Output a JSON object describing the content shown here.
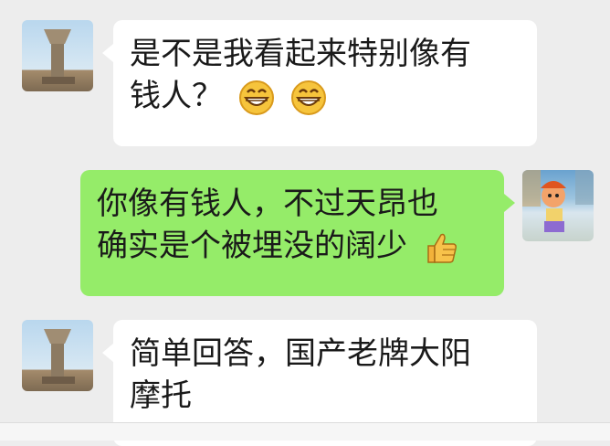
{
  "chat": {
    "messages": [
      {
        "side": "left",
        "text_line1": "是不是我看起来特别像有",
        "text_line2": "钱人？",
        "emojis": [
          "grin-emoji",
          "grin-emoji"
        ]
      },
      {
        "side": "right",
        "text_line1": "你像有钱人，不过天昂也",
        "text_line2": "确实是个被埋没的阔少",
        "emojis": [
          "thumbs-up-emoji"
        ]
      },
      {
        "side": "left",
        "text_line1": "简单回答，国产老牌大阳",
        "text_line2": "摩托"
      }
    ]
  },
  "colors": {
    "background": "#ededed",
    "bubble_incoming": "#ffffff",
    "bubble_outgoing": "#95ec69"
  }
}
